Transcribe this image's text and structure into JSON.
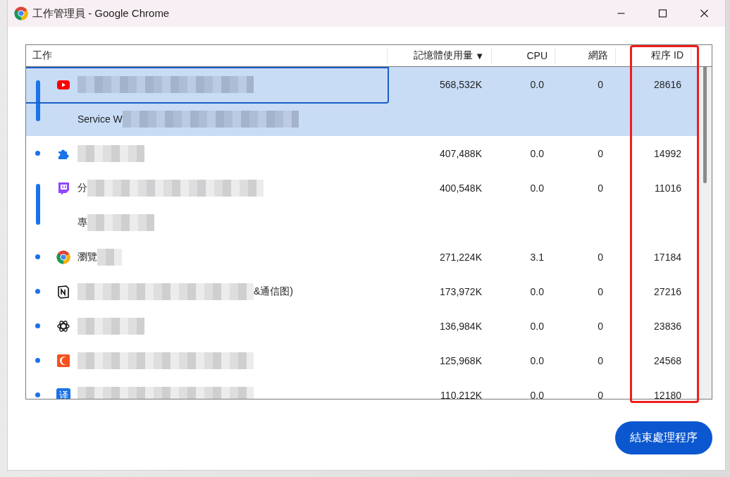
{
  "window": {
    "title": "工作管理員 - Google Chrome"
  },
  "table": {
    "columns": [
      {
        "label": "工作",
        "sorted": false,
        "highlighted": false
      },
      {
        "label": "記憶體使用量",
        "sorted": true,
        "highlighted": false
      },
      {
        "label": "CPU",
        "sorted": false,
        "highlighted": false
      },
      {
        "label": "網路",
        "sorted": false,
        "highlighted": false
      },
      {
        "label": "程序 ID",
        "sorted": false,
        "highlighted": true
      }
    ],
    "sort_arrow": "▼",
    "rows": [
      {
        "kind": "youtube",
        "selected": true,
        "focused": true,
        "lines": [
          [
            {
              "kind": "blur-long"
            }
          ],
          [
            {
              "kind": "text",
              "text": "Service W"
            },
            {
              "kind": "blur-long"
            }
          ]
        ],
        "memory": "568,532K",
        "cpu": "0.0",
        "network": "0",
        "pid": "28616"
      },
      {
        "kind": "puzzle",
        "selected": false,
        "focused": false,
        "lines": [
          [
            {
              "kind": "blur"
            }
          ]
        ],
        "memory": "407,488K",
        "cpu": "0.0",
        "network": "0",
        "pid": "14992"
      },
      {
        "kind": "twitch",
        "selected": false,
        "focused": false,
        "lines": [
          [
            {
              "kind": "text",
              "text": "分"
            },
            {
              "kind": "blur-long"
            }
          ],
          [
            {
              "kind": "text",
              "text": "專"
            },
            {
              "kind": "blur"
            }
          ]
        ],
        "memory": "400,548K",
        "cpu": "0.0",
        "network": "0",
        "pid": "11016"
      },
      {
        "kind": "chrome",
        "selected": false,
        "focused": false,
        "lines": [
          [
            {
              "kind": "text",
              "text": "瀏覽"
            },
            {
              "kind": "blur-short"
            }
          ]
        ],
        "memory": "271,224K",
        "cpu": "3.1",
        "network": "0",
        "pid": "17184"
      },
      {
        "kind": "notion",
        "selected": false,
        "focused": false,
        "lines": [
          [
            {
              "kind": "blur-long"
            },
            {
              "kind": "text",
              "text": "&通信图)"
            }
          ]
        ],
        "memory": "173,972K",
        "cpu": "0.0",
        "network": "0",
        "pid": "27216"
      },
      {
        "kind": "openai",
        "selected": false,
        "focused": false,
        "lines": [
          [
            {
              "kind": "blur"
            }
          ]
        ],
        "memory": "136,984K",
        "cpu": "0.0",
        "network": "0",
        "pid": "23836"
      },
      {
        "kind": "crescent",
        "selected": false,
        "focused": false,
        "lines": [
          [
            {
              "kind": "blur-long"
            }
          ]
        ],
        "memory": "125,968K",
        "cpu": "0.0",
        "network": "0",
        "pid": "24568"
      },
      {
        "kind": "translate",
        "icon_text": "译",
        "selected": false,
        "focused": false,
        "lines": [
          [
            {
              "kind": "blur-long"
            }
          ]
        ],
        "memory": "110,212K",
        "cpu": "0.0",
        "network": "0",
        "pid": "12180"
      }
    ]
  },
  "buttons": [
    {
      "label": "結束處理程序"
    }
  ]
}
